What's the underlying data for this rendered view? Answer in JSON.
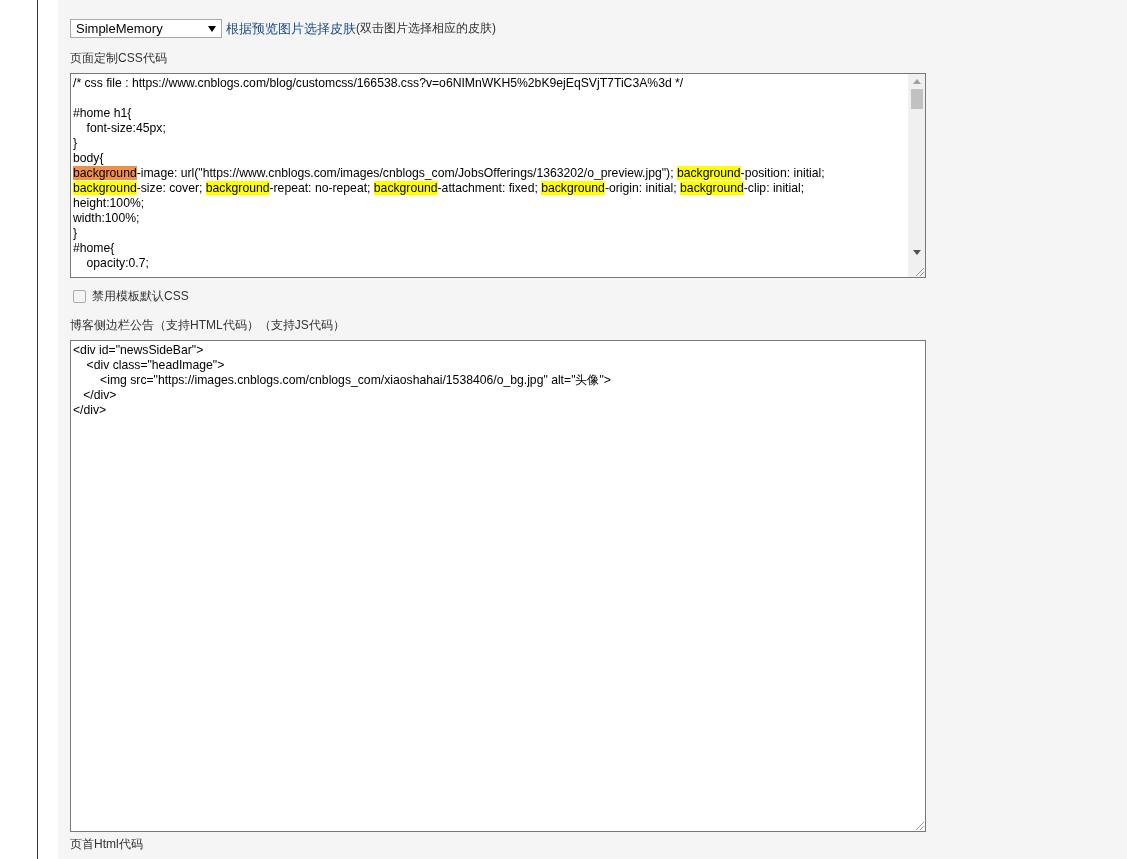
{
  "skin": {
    "select": "SimpleMemory",
    "link": "根据预览图片选择皮肤",
    "hint": "(双击图片选择相应的皮肤)"
  },
  "css_section": {
    "label": "页面定制CSS代码",
    "lines": [
      {
        "kind": "code",
        "segments": [
          {
            "text": "/* css file : https://www.cnblogs.com/blog/customcss/166538.css?v=o6NIMnWKH5%2bK9ejEqSVjT7TiC3A%3d */",
            "highlighted": false
          }
        ]
      },
      {
        "kind": "blank"
      },
      {
        "kind": "code",
        "segments": [
          {
            "text": "#home h1{",
            "highlighted": false
          }
        ]
      },
      {
        "kind": "code",
        "segments": [
          {
            "text": "    font-size:45px;",
            "highlighted": false
          }
        ]
      },
      {
        "kind": "code",
        "segments": [
          {
            "text": "}",
            "highlighted": false
          }
        ]
      },
      {
        "kind": "code",
        "segments": [
          {
            "text": "body{",
            "highlighted": false
          }
        ]
      },
      {
        "kind": "code",
        "segments": [
          {
            "text": "background",
            "highlighted": true,
            "current": true
          },
          {
            "text": "-image: url(\"https://www.cnblogs.com/images/cnblogs_com/JobsOfferings/1363202/o_preview.jpg\"); ",
            "highlighted": false
          },
          {
            "text": "background",
            "highlighted": true,
            "current": false
          },
          {
            "text": "-position: initial;",
            "highlighted": false
          }
        ]
      },
      {
        "kind": "code",
        "segments": [
          {
            "text": "background",
            "highlighted": true,
            "current": false
          },
          {
            "text": "-size: cover; ",
            "highlighted": false
          },
          {
            "text": "background",
            "highlighted": true,
            "current": false
          },
          {
            "text": "-repeat: no-repeat; ",
            "highlighted": false
          },
          {
            "text": "background",
            "highlighted": true,
            "current": false
          },
          {
            "text": "-attachment: fixed; ",
            "highlighted": false
          },
          {
            "text": "background",
            "highlighted": true,
            "current": false
          },
          {
            "text": "-origin: initial; ",
            "highlighted": false
          },
          {
            "text": "background",
            "highlighted": true,
            "current": false
          },
          {
            "text": "-clip: initial;",
            "highlighted": false
          }
        ]
      },
      {
        "kind": "code",
        "segments": [
          {
            "text": "height:100%;",
            "highlighted": false
          }
        ]
      },
      {
        "kind": "code",
        "segments": [
          {
            "text": "width:100%;",
            "highlighted": false
          }
        ]
      },
      {
        "kind": "code",
        "segments": [
          {
            "text": "}",
            "highlighted": false
          }
        ]
      },
      {
        "kind": "code",
        "segments": [
          {
            "text": "#home{",
            "highlighted": false
          }
        ]
      },
      {
        "kind": "code",
        "segments": [
          {
            "text": "    opacity:0.7;",
            "highlighted": false
          }
        ]
      }
    ]
  },
  "disable_default_css": {
    "label": "禁用模板默认CSS",
    "checked": false
  },
  "sidebar_section": {
    "label": "博客侧边栏公告（支持HTML代码）（支持JS代码）",
    "lines": [
      "<div id=\"newsSideBar\">",
      "    <div class=\"headImage\">",
      "        <img src=\"https://images.cnblogs.com/cnblogs_com/xiaoshahai/1538406/o_bg.jpg\" alt=\"头像\">",
      "   </div>",
      "</div>"
    ]
  },
  "next_section": {
    "label": "页首Html代码"
  }
}
